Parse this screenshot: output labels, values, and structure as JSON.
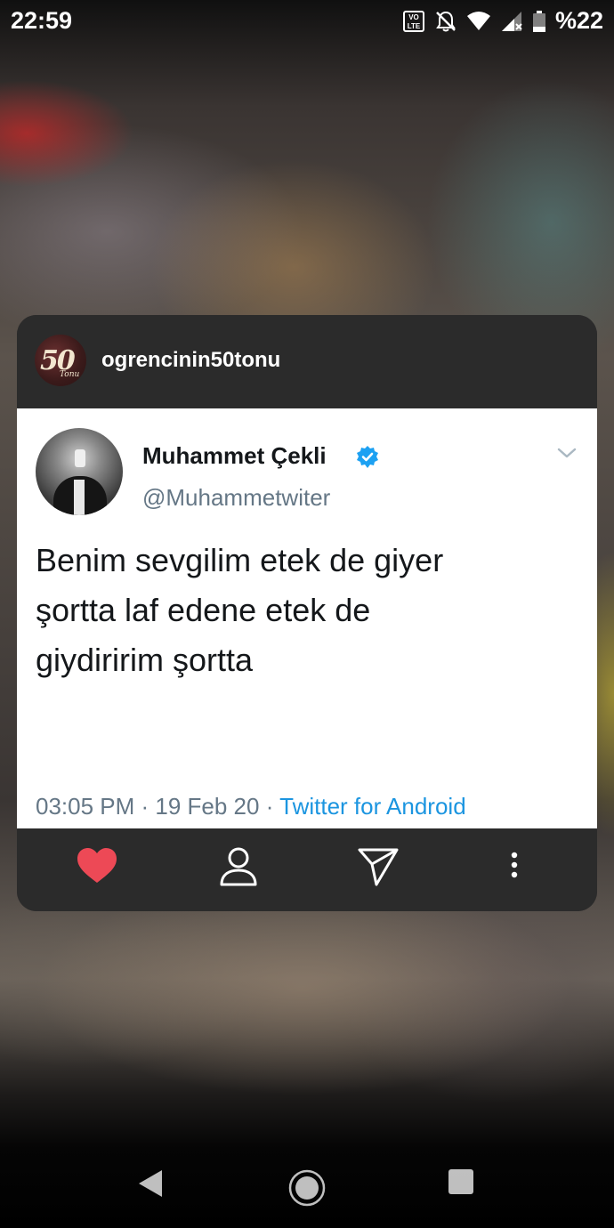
{
  "status_bar": {
    "time": "22:59",
    "battery_text": "%22",
    "icons": [
      "volte-lte-icon",
      "notifications-off-icon",
      "wifi-icon",
      "signal-icon",
      "battery-icon"
    ]
  },
  "post": {
    "username": "ogrencinin50tonu",
    "avatar_text_number": "50",
    "avatar_text_sub": "Tonu"
  },
  "tweet": {
    "name": "Muhammet Çekli",
    "handle": "@Muhammetwiter",
    "text_lines": [
      "Benim sevgilim etek de giyer",
      "şortta laf edene etek de",
      "giydiririm şortta"
    ],
    "time_date": "03:05 PM · 19 Feb 20 · ",
    "source": "Twitter for Android",
    "verified_color": "#1da1f2"
  },
  "colors": {
    "like_active": "#ed4956",
    "tweet_gray": "#657786",
    "link_blue": "#1b95e0"
  },
  "bottom_actions": [
    "heart-icon",
    "profile-icon",
    "send-icon",
    "more-vertical-icon"
  ],
  "nav": [
    "back-icon",
    "home-icon",
    "recents-icon"
  ]
}
